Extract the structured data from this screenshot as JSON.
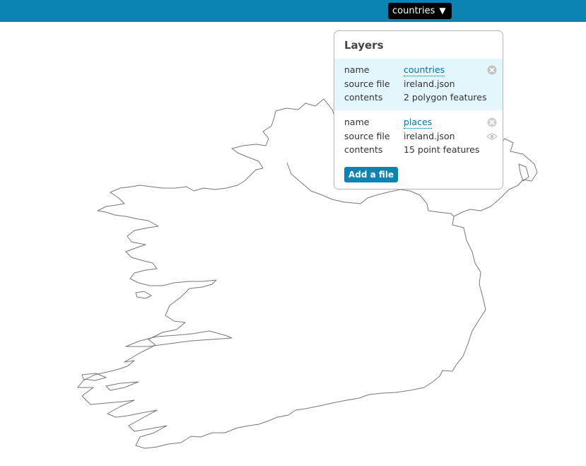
{
  "topbar": {
    "selected_layer": "countries",
    "accent_color": "#0b83b3"
  },
  "layers_panel": {
    "title": "Layers",
    "layers": [
      {
        "name_label": "name",
        "name": "countries",
        "source_label": "source file",
        "source": "ireland.json",
        "contents_label": "contents",
        "contents": "2 polygon features",
        "active": true,
        "icons": [
          "close-icon"
        ]
      },
      {
        "name_label": "name",
        "name": "places",
        "source_label": "source file",
        "source": "ireland.json",
        "contents_label": "contents",
        "contents": "15 point features",
        "active": false,
        "icons": [
          "close-icon",
          "eye-icon"
        ]
      }
    ],
    "add_button": "Add a file"
  },
  "map": {
    "stroke_color": "#777777"
  }
}
